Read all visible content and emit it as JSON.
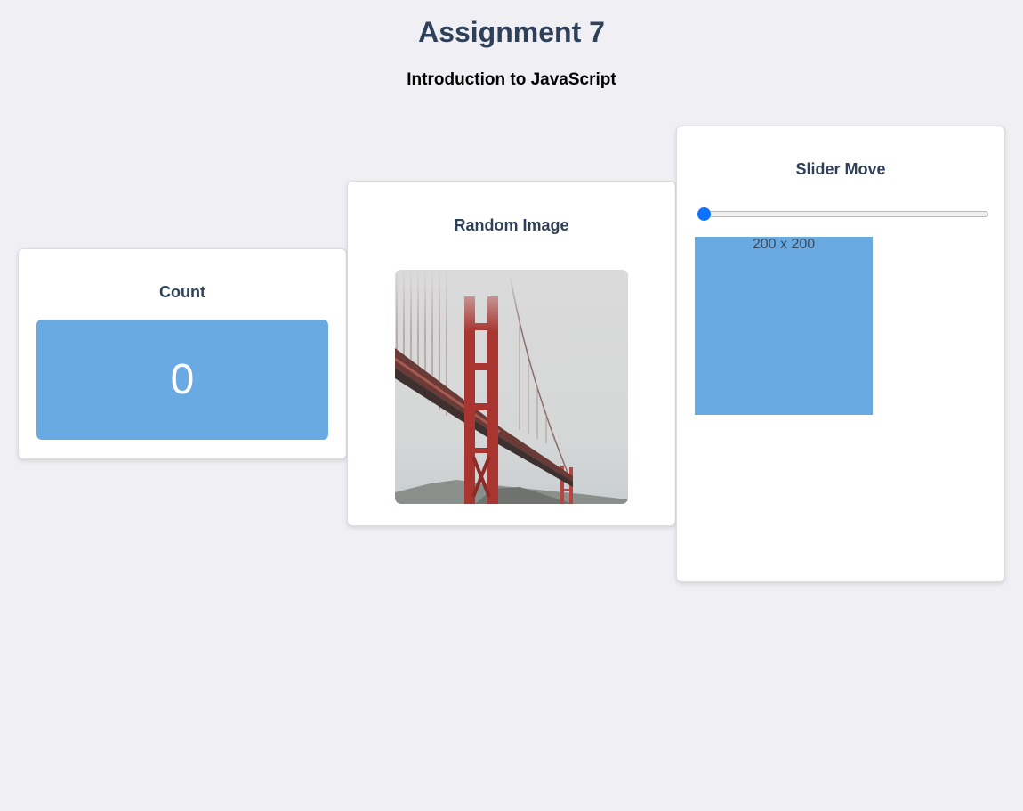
{
  "header": {
    "title": "Assignment 7",
    "subtitle": "Introduction to JavaScript"
  },
  "count_card": {
    "title": "Count",
    "value": "0"
  },
  "image_card": {
    "title": "Random Image",
    "image_alt": "Golden Gate Bridge in fog"
  },
  "slider_card": {
    "title": "Slider Move",
    "slider_value": 0,
    "box_label": "200 x 200"
  },
  "colors": {
    "background": "#f0f0f4",
    "heading": "#2f4059",
    "box_blue": "#6aaae3",
    "slider_thumb": "#0b74ff",
    "card": "#ffffff"
  }
}
